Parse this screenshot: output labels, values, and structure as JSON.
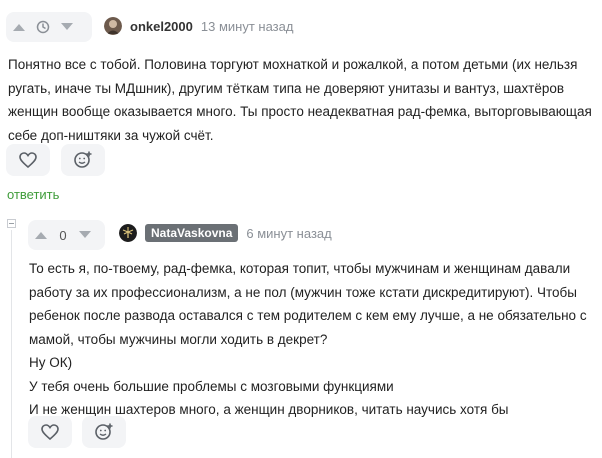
{
  "comment1": {
    "username": "onkel2000",
    "time": "13 минут назад",
    "text": "Понятно все с тобой. Половина торгуют мохнаткой и рожалкой, а потом детьми (их нельзя ругать, иначе ты МДшник), другим тёткам типа не доверяют унитазы и вантуз, шахтёров женщин вообще оказывается много. Ты просто неадекватная рад-фемка, выторговывающая себе доп-ништяки за чужой счёт.",
    "reply_label": "ответить"
  },
  "comment2": {
    "score": "0",
    "username": "NataVaskovna",
    "time": "6 минут назад",
    "lines": [
      "То есть я, по-твоему, рад-фемка, которая топит, чтобы мужчинам и женщинам давали работу за их профессионализм, а не пол (мужчин тоже кстати дискредитируют). Чтобы ребенок после развода оставался с тем родителем с кем ему лучше, а не обязательно с мамой, чтобы мужчины могли ходить в декрет?",
      "Ну ОК)",
      "У тебя очень большие проблемы с мозговыми функциями",
      "И не женщин шахтеров много, а женщин дворников, читать научись хотя бы"
    ]
  },
  "colors": {
    "accent_green": "#3f9c3a",
    "muted_gray": "#8a8f96",
    "button_bg": "#f3f4f6"
  }
}
